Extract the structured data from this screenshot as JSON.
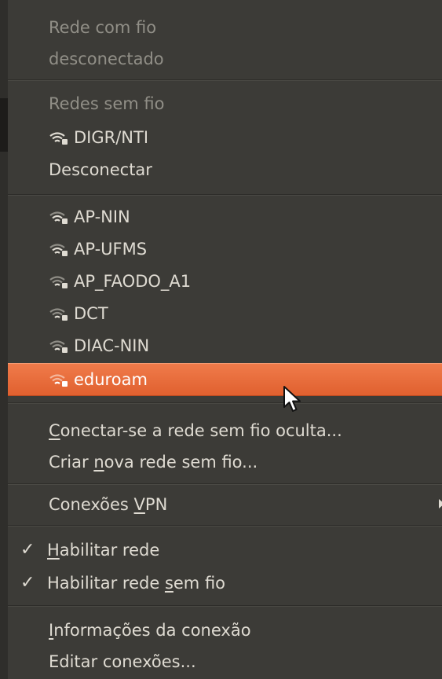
{
  "wired": {
    "title": "Rede com fio",
    "status": "desconectado"
  },
  "wireless": {
    "title": "Redes sem fio",
    "connected": "DIGR/NTI",
    "disconnect": "Desconectar"
  },
  "networks": [
    "AP-NIN",
    "AP-UFMS",
    "AP_FAODO_A1",
    "DCT",
    "DIAC-NIN",
    "eduroam"
  ],
  "actions": {
    "hidden_pre": "",
    "hidden_u": "C",
    "hidden_post": "onectar-se a rede sem fio oculta...",
    "create_pre": "Criar ",
    "create_u": "n",
    "create_post": "ova rede sem fio..."
  },
  "vpn": {
    "pre": "Conexões ",
    "u": "V",
    "post": "PN"
  },
  "toggles": {
    "check": "✓",
    "net_pre": "",
    "net_u": "H",
    "net_post": "abilitar rede",
    "wifi_pre": "Habilitar rede ",
    "wifi_u": "s",
    "wifi_post": "em fio"
  },
  "info": {
    "info_pre": "",
    "info_u": "I",
    "info_post": "nformações da conexão",
    "edit": "Editar conexões..."
  },
  "colors": {
    "menu_bg": "#3c3b37",
    "highlight": "#e96b3c",
    "text": "#dfdbd2",
    "disabled": "#918f87"
  },
  "highlighted_network": "eduroam"
}
